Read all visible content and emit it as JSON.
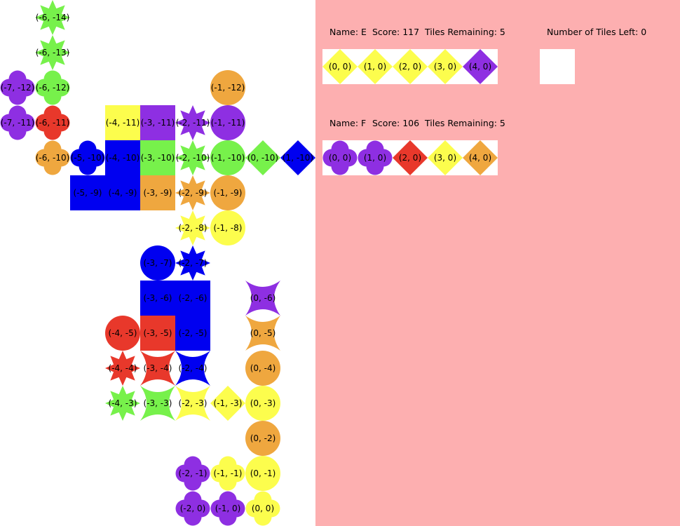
{
  "players": [
    {
      "name_text": "Name: E",
      "score_text": "Score: 117",
      "remaining_text": "Tiles Remaining: 5",
      "hand": [
        {
          "label": "(0, 0)",
          "shape": "diamond",
          "color": "yellow"
        },
        {
          "label": "(1, 0)",
          "shape": "diamond",
          "color": "yellow"
        },
        {
          "label": "(2, 0)",
          "shape": "diamond",
          "color": "yellow"
        },
        {
          "label": "(3, 0)",
          "shape": "diamond",
          "color": "yellow"
        },
        {
          "label": "(4, 0)",
          "shape": "diamond",
          "color": "purple"
        }
      ]
    },
    {
      "name_text": "Name: F",
      "score_text": "Score: 106",
      "remaining_text": "Tiles Remaining: 5",
      "hand": [
        {
          "label": "(0, 0)",
          "shape": "clover",
          "color": "purple"
        },
        {
          "label": "(1, 0)",
          "shape": "clover",
          "color": "purple"
        },
        {
          "label": "(2, 0)",
          "shape": "diamond",
          "color": "red"
        },
        {
          "label": "(3, 0)",
          "shape": "diamond",
          "color": "yellow"
        },
        {
          "label": "(4, 0)",
          "shape": "diamond",
          "color": "orange"
        }
      ]
    }
  ],
  "tiles_left_text": "Number of Tiles Left: 0",
  "colors": {
    "red": "#e8382b",
    "green": "#77f14b",
    "blue": "#0000f0",
    "yellow": "#fcfd4d",
    "orange": "#efa73f",
    "purple": "#8e2fe2",
    "side_background": "#fdafb0"
  },
  "board_tiles": [
    {
      "x": -6,
      "y": -14,
      "label": "(-6, -14)",
      "shape": "star8",
      "color": "green"
    },
    {
      "x": -6,
      "y": -13,
      "label": "(-6, -13)",
      "shape": "star8",
      "color": "green"
    },
    {
      "x": -7,
      "y": -12,
      "label": "(-7, -12)",
      "shape": "clover",
      "color": "purple"
    },
    {
      "x": -6,
      "y": -12,
      "label": "(-6, -12)",
      "shape": "clover",
      "color": "green"
    },
    {
      "x": -1,
      "y": -12,
      "label": "(-1, -12)",
      "shape": "circle",
      "color": "orange"
    },
    {
      "x": -7,
      "y": -11,
      "label": "(-7, -11)",
      "shape": "clover",
      "color": "purple"
    },
    {
      "x": -6,
      "y": -11,
      "label": "(-6, -11)",
      "shape": "clover",
      "color": "red"
    },
    {
      "x": -4,
      "y": -11,
      "label": "(-4, -11)",
      "shape": "square",
      "color": "yellow"
    },
    {
      "x": -3,
      "y": -11,
      "label": "(-3, -11)",
      "shape": "square",
      "color": "purple"
    },
    {
      "x": -2,
      "y": -11,
      "label": "(-2, -11)",
      "shape": "star8",
      "color": "purple"
    },
    {
      "x": -1,
      "y": -11,
      "label": "(-1, -11)",
      "shape": "circle",
      "color": "purple"
    },
    {
      "x": -6,
      "y": -10,
      "label": "(-6, -10)",
      "shape": "clover",
      "color": "orange"
    },
    {
      "x": -5,
      "y": -10,
      "label": "(-5, -10)",
      "shape": "clover",
      "color": "blue"
    },
    {
      "x": -4,
      "y": -10,
      "label": "(-4, -10)",
      "shape": "square",
      "color": "blue"
    },
    {
      "x": -3,
      "y": -10,
      "label": "(-3, -10)",
      "shape": "square",
      "color": "green"
    },
    {
      "x": -2,
      "y": -10,
      "label": "(-2, -10)",
      "shape": "star8",
      "color": "green"
    },
    {
      "x": -1,
      "y": -10,
      "label": "(-1, -10)",
      "shape": "circle",
      "color": "green"
    },
    {
      "x": 0,
      "y": -10,
      "label": "(0, -10)",
      "shape": "diamond",
      "color": "green"
    },
    {
      "x": 1,
      "y": -10,
      "label": "(1, -10)",
      "shape": "diamond",
      "color": "blue"
    },
    {
      "x": -5,
      "y": -9,
      "label": "(-5, -9)",
      "shape": "square",
      "color": "blue"
    },
    {
      "x": -4,
      "y": -9,
      "label": "(-4, -9)",
      "shape": "square",
      "color": "blue"
    },
    {
      "x": -3,
      "y": -9,
      "label": "(-3, -9)",
      "shape": "square",
      "color": "orange"
    },
    {
      "x": -2,
      "y": -9,
      "label": "(-2, -9)",
      "shape": "star8",
      "color": "orange"
    },
    {
      "x": -1,
      "y": -9,
      "label": "(-1, -9)",
      "shape": "circle",
      "color": "orange"
    },
    {
      "x": -2,
      "y": -8,
      "label": "(-2, -8)",
      "shape": "star8",
      "color": "yellow"
    },
    {
      "x": -1,
      "y": -8,
      "label": "(-1, -8)",
      "shape": "circle",
      "color": "yellow"
    },
    {
      "x": -3,
      "y": -7,
      "label": "(-3, -7)",
      "shape": "circle",
      "color": "blue"
    },
    {
      "x": -2,
      "y": -7,
      "label": "(-2, -7)",
      "shape": "star8",
      "color": "blue"
    },
    {
      "x": -3,
      "y": -6,
      "label": "(-3, -6)",
      "shape": "square",
      "color": "blue"
    },
    {
      "x": -2,
      "y": -6,
      "label": "(-2, -6)",
      "shape": "square",
      "color": "blue"
    },
    {
      "x": 0,
      "y": -6,
      "label": "(0, -6)",
      "shape": "star4",
      "color": "purple"
    },
    {
      "x": -4,
      "y": -5,
      "label": "(-4, -5)",
      "shape": "circle",
      "color": "red"
    },
    {
      "x": -3,
      "y": -5,
      "label": "(-3, -5)",
      "shape": "square",
      "color": "red"
    },
    {
      "x": -2,
      "y": -5,
      "label": "(-2, -5)",
      "shape": "square",
      "color": "blue"
    },
    {
      "x": 0,
      "y": -5,
      "label": "(0, -5)",
      "shape": "star4",
      "color": "orange"
    },
    {
      "x": -4,
      "y": -4,
      "label": "(-4, -4)",
      "shape": "star8",
      "color": "red"
    },
    {
      "x": -3,
      "y": -4,
      "label": "(-3, -4)",
      "shape": "star4",
      "color": "red"
    },
    {
      "x": -2,
      "y": -4,
      "label": "(-2, -4)",
      "shape": "star4",
      "color": "blue"
    },
    {
      "x": 0,
      "y": -4,
      "label": "(0, -4)",
      "shape": "circle",
      "color": "orange"
    },
    {
      "x": -4,
      "y": -3,
      "label": "(-4, -3)",
      "shape": "star8",
      "color": "green"
    },
    {
      "x": -3,
      "y": -3,
      "label": "(-3, -3)",
      "shape": "star4",
      "color": "green"
    },
    {
      "x": -2,
      "y": -3,
      "label": "(-2, -3)",
      "shape": "star4",
      "color": "yellow"
    },
    {
      "x": -1,
      "y": -3,
      "label": "(-1, -3)",
      "shape": "diamond",
      "color": "yellow"
    },
    {
      "x": 0,
      "y": -3,
      "label": "(0, -3)",
      "shape": "circle",
      "color": "yellow"
    },
    {
      "x": 0,
      "y": -2,
      "label": "(0, -2)",
      "shape": "circle",
      "color": "orange"
    },
    {
      "x": -2,
      "y": -1,
      "label": "(-2, -1)",
      "shape": "clover",
      "color": "purple"
    },
    {
      "x": -1,
      "y": -1,
      "label": "(-1, -1)",
      "shape": "clover",
      "color": "yellow"
    },
    {
      "x": 0,
      "y": -1,
      "label": "(0, -1)",
      "shape": "circle",
      "color": "yellow"
    },
    {
      "x": -2,
      "y": 0,
      "label": "(-2, 0)",
      "shape": "clover",
      "color": "purple"
    },
    {
      "x": -1,
      "y": 0,
      "label": "(-1, 0)",
      "shape": "clover",
      "color": "purple"
    },
    {
      "x": 0,
      "y": 0,
      "label": "(0, 0)",
      "shape": "clover",
      "color": "yellow"
    }
  ]
}
